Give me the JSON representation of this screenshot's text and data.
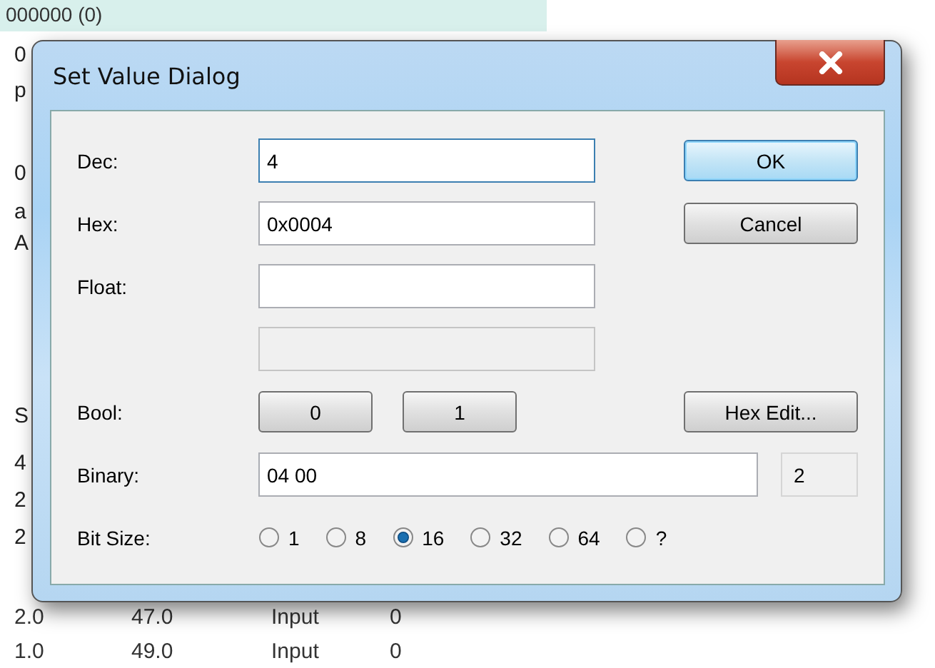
{
  "background": {
    "header": "000000 (0)",
    "fragments": [
      "0",
      "p",
      "0",
      "a",
      "A",
      "S",
      "4",
      "2",
      "2"
    ],
    "rows": [
      [
        "2.0",
        "47.0",
        "Input",
        "0"
      ],
      [
        "1.0",
        "49.0",
        "Input",
        "0"
      ]
    ]
  },
  "dialog": {
    "title": "Set Value Dialog",
    "rows": [
      {
        "kind": "input",
        "label": "Dec:",
        "value": "4",
        "focused": true,
        "button": {
          "label": "OK",
          "default": true
        }
      },
      {
        "kind": "input",
        "label": "Hex:",
        "value": "0x0004",
        "focused": false,
        "button": {
          "label": "Cancel",
          "default": false
        }
      },
      {
        "kind": "input",
        "label": "Float:",
        "focused": false
      },
      {
        "kind": "disabled"
      },
      {
        "kind": "buttons",
        "label": "Bool:",
        "buttons": [
          "0",
          "1"
        ],
        "button": {
          "label": "Hex Edit...",
          "default": false
        }
      },
      {
        "kind": "binary",
        "label": "Binary:",
        "value": "04 00",
        "count": "2"
      },
      {
        "kind": "radios",
        "label": "Bit Size:",
        "options": [
          {
            "label": "1",
            "selected": false
          },
          {
            "label": "8",
            "selected": false
          },
          {
            "label": "16",
            "selected": true
          },
          {
            "label": "32",
            "selected": false
          },
          {
            "label": "64",
            "selected": false
          },
          {
            "label": "?",
            "selected": false
          }
        ]
      }
    ]
  }
}
